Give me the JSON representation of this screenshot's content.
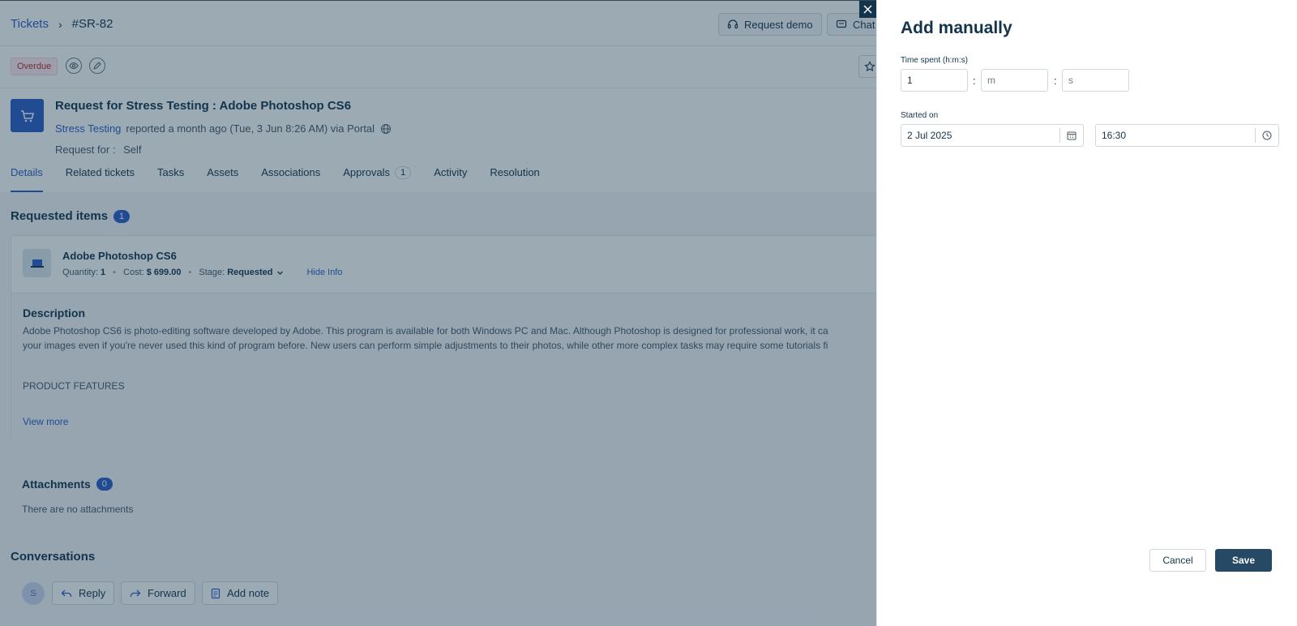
{
  "breadcrumb": {
    "parent": "Tickets",
    "separator": "›",
    "current": "#SR-82"
  },
  "topbar": {
    "request_demo": "Request demo",
    "chat": "Chat"
  },
  "status_badge": "Overdue",
  "ticket": {
    "title": "Request for Stress Testing : Adobe Photoshop CS6",
    "requester": "Stress Testing",
    "meta": "reported a month ago (Tue, 3 Jun 8:26 AM) via Portal",
    "request_for_label": "Request for :",
    "request_for_value": "Self"
  },
  "tabs": [
    {
      "label": "Details"
    },
    {
      "label": "Related tickets"
    },
    {
      "label": "Tasks"
    },
    {
      "label": "Assets"
    },
    {
      "label": "Associations"
    },
    {
      "label": "Approvals",
      "count": "1"
    },
    {
      "label": "Activity"
    },
    {
      "label": "Resolution"
    }
  ],
  "requested_items": {
    "title": "Requested items",
    "count": "1",
    "item": {
      "name": "Adobe Photoshop CS6",
      "quantity_label": "Quantity:",
      "quantity": "1",
      "cost_label": "Cost:",
      "cost": "$ 699.00",
      "stage_label": "Stage:",
      "stage": "Requested",
      "hide_info": "Hide Info"
    },
    "description": {
      "title": "Description",
      "line1": "Adobe Photoshop CS6 is photo-editing software developed by Adobe. This program is available for both Windows PC and Mac. Although Photoshop is designed for professional work, it ca",
      "line2": "your images even if you're never used this kind of program before. New users can perform simple adjustments to their photos, while other more complex tasks may require some tutorials fi",
      "features": "PRODUCT FEATURES",
      "view_more": "View more"
    }
  },
  "attachments": {
    "title": "Attachments",
    "count": "0",
    "empty": "There are no attachments"
  },
  "conversations": {
    "title": "Conversations",
    "avatar": "S",
    "reply": "Reply",
    "forward": "Forward",
    "add_note": "Add note"
  },
  "drawer": {
    "title": "Add manually",
    "time_label": "Time spent (h:m:s)",
    "hours_value": "1",
    "minutes_placeholder": "m",
    "seconds_placeholder": "s",
    "colon": ":",
    "started_label": "Started on",
    "date_value": "2 Jul 2025",
    "time_value": "16:30",
    "cancel": "Cancel",
    "save": "Save"
  },
  "colors": {
    "accent": "#2c5cc5",
    "primary_button": "#264966",
    "overdue": "#c82124"
  }
}
